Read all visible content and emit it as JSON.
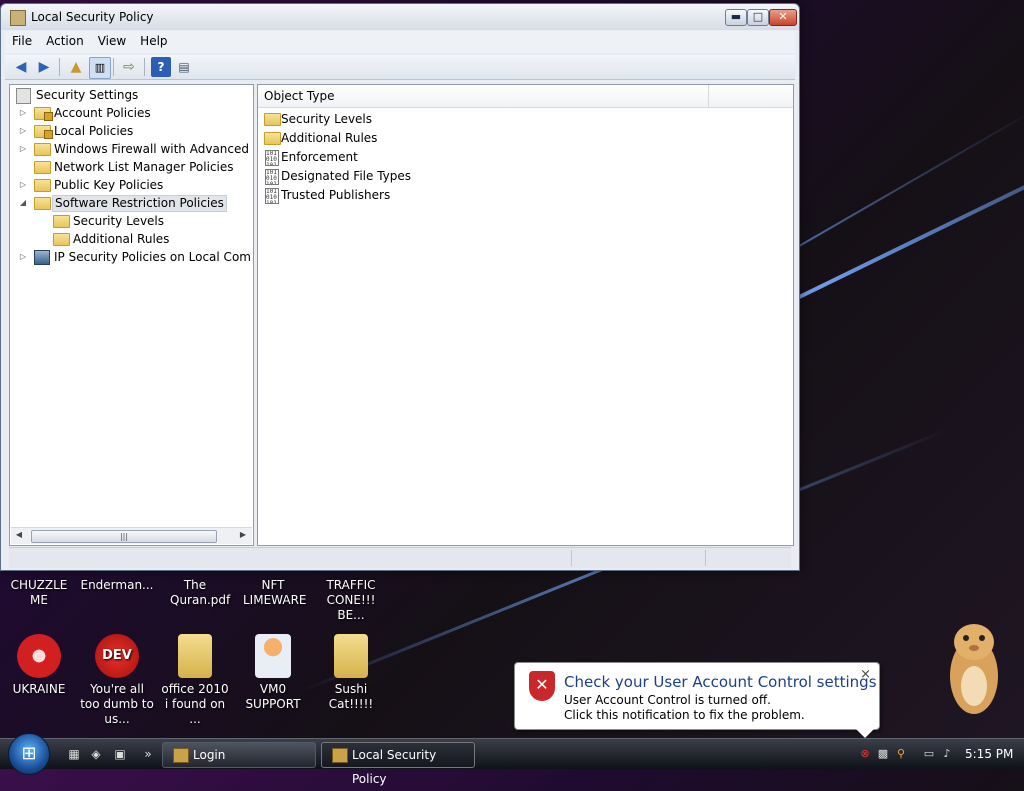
{
  "window": {
    "title": "Local Security Policy",
    "menu": [
      "File",
      "Action",
      "View",
      "Help"
    ]
  },
  "tree": {
    "root": "Security Settings",
    "items": [
      {
        "label": "Account Policies",
        "expander": "▷"
      },
      {
        "label": "Local Policies",
        "expander": "▷"
      },
      {
        "label": "Windows Firewall with Advanced Secu",
        "expander": "▷"
      },
      {
        "label": "Network List Manager Policies",
        "expander": ""
      },
      {
        "label": "Public Key Policies",
        "expander": "▷"
      },
      {
        "label": "Software Restriction Policies",
        "expander": "◢"
      },
      {
        "label": "Security Levels",
        "expander": ""
      },
      {
        "label": "Additional Rules",
        "expander": ""
      },
      {
        "label": "IP Security Policies on Local Compute",
        "expander": "▷"
      }
    ]
  },
  "list": {
    "column": "Object Type",
    "items": [
      {
        "label": "Security Levels",
        "icon": "folder-icon"
      },
      {
        "label": "Additional Rules",
        "icon": "folder-icon"
      },
      {
        "label": "Enforcement",
        "icon": "binary-icon"
      },
      {
        "label": "Designated File Types",
        "icon": "binary-icon"
      },
      {
        "label": "Trusted Publishers",
        "icon": "binary-icon"
      }
    ]
  },
  "desktop": {
    "top_row": [
      "CHUZZLE ME",
      "Enderman...",
      "The Quran.pdf",
      "NFT LIMEWARE",
      "TRAFFIC CONE!!! BE..."
    ],
    "bottom_row": [
      "UKRAINE",
      "You're all too dumb to us...",
      "office 2010 i found on ...",
      "VM0 SUPPORT",
      "Sushi Cat!!!!!"
    ]
  },
  "notification": {
    "title": "Check your User Account Control settings",
    "line1": "User Account Control is turned off.",
    "line2": "Click this notification to fix the problem.",
    "close": "×"
  },
  "taskbar": {
    "buttons": [
      "Login",
      "Local Security Policy"
    ],
    "clock": "5:15 PM"
  }
}
